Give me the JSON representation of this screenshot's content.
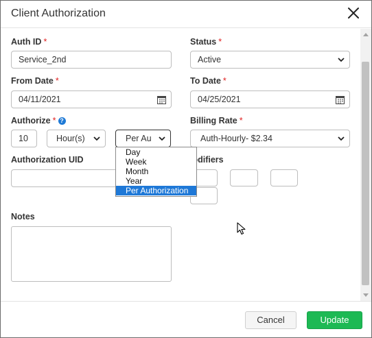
{
  "dialog": {
    "title": "Client Authorization"
  },
  "form": {
    "auth_id": {
      "label": "Auth ID",
      "required": "*",
      "value": "Service_2nd"
    },
    "status": {
      "label": "Status",
      "required": "*",
      "value": "Active"
    },
    "from_date": {
      "label": "From Date",
      "required": "*",
      "value": "04/11/2021"
    },
    "to_date": {
      "label": "To Date",
      "required": "*",
      "value": "04/25/2021"
    },
    "authorize": {
      "label": "Authorize",
      "required": "*",
      "help_icon": "question-circle-icon",
      "help_glyph": "?",
      "quantity": "10",
      "unit": "Hour(s)",
      "period": "Per Au",
      "period_options": [
        "Day",
        "Week",
        "Month",
        "Year",
        "Per Authorization"
      ],
      "period_selected": "Per Authorization"
    },
    "billing_rate": {
      "label": "Billing Rate",
      "required": "*",
      "value": "Auth-Hourly- $2.34"
    },
    "authorization_uid": {
      "label": "Authorization UID",
      "value": ""
    },
    "modifiers": {
      "label": "Modifiers",
      "visible_label": "lodifiers",
      "values": [
        "",
        "",
        "",
        "",
        ""
      ]
    },
    "notes": {
      "label": "Notes",
      "value": ""
    }
  },
  "footer": {
    "cancel_label": "Cancel",
    "update_label": "Update"
  },
  "colors": {
    "accent": "#1e78d7",
    "update_button": "#1db954",
    "required": "#e02020"
  }
}
